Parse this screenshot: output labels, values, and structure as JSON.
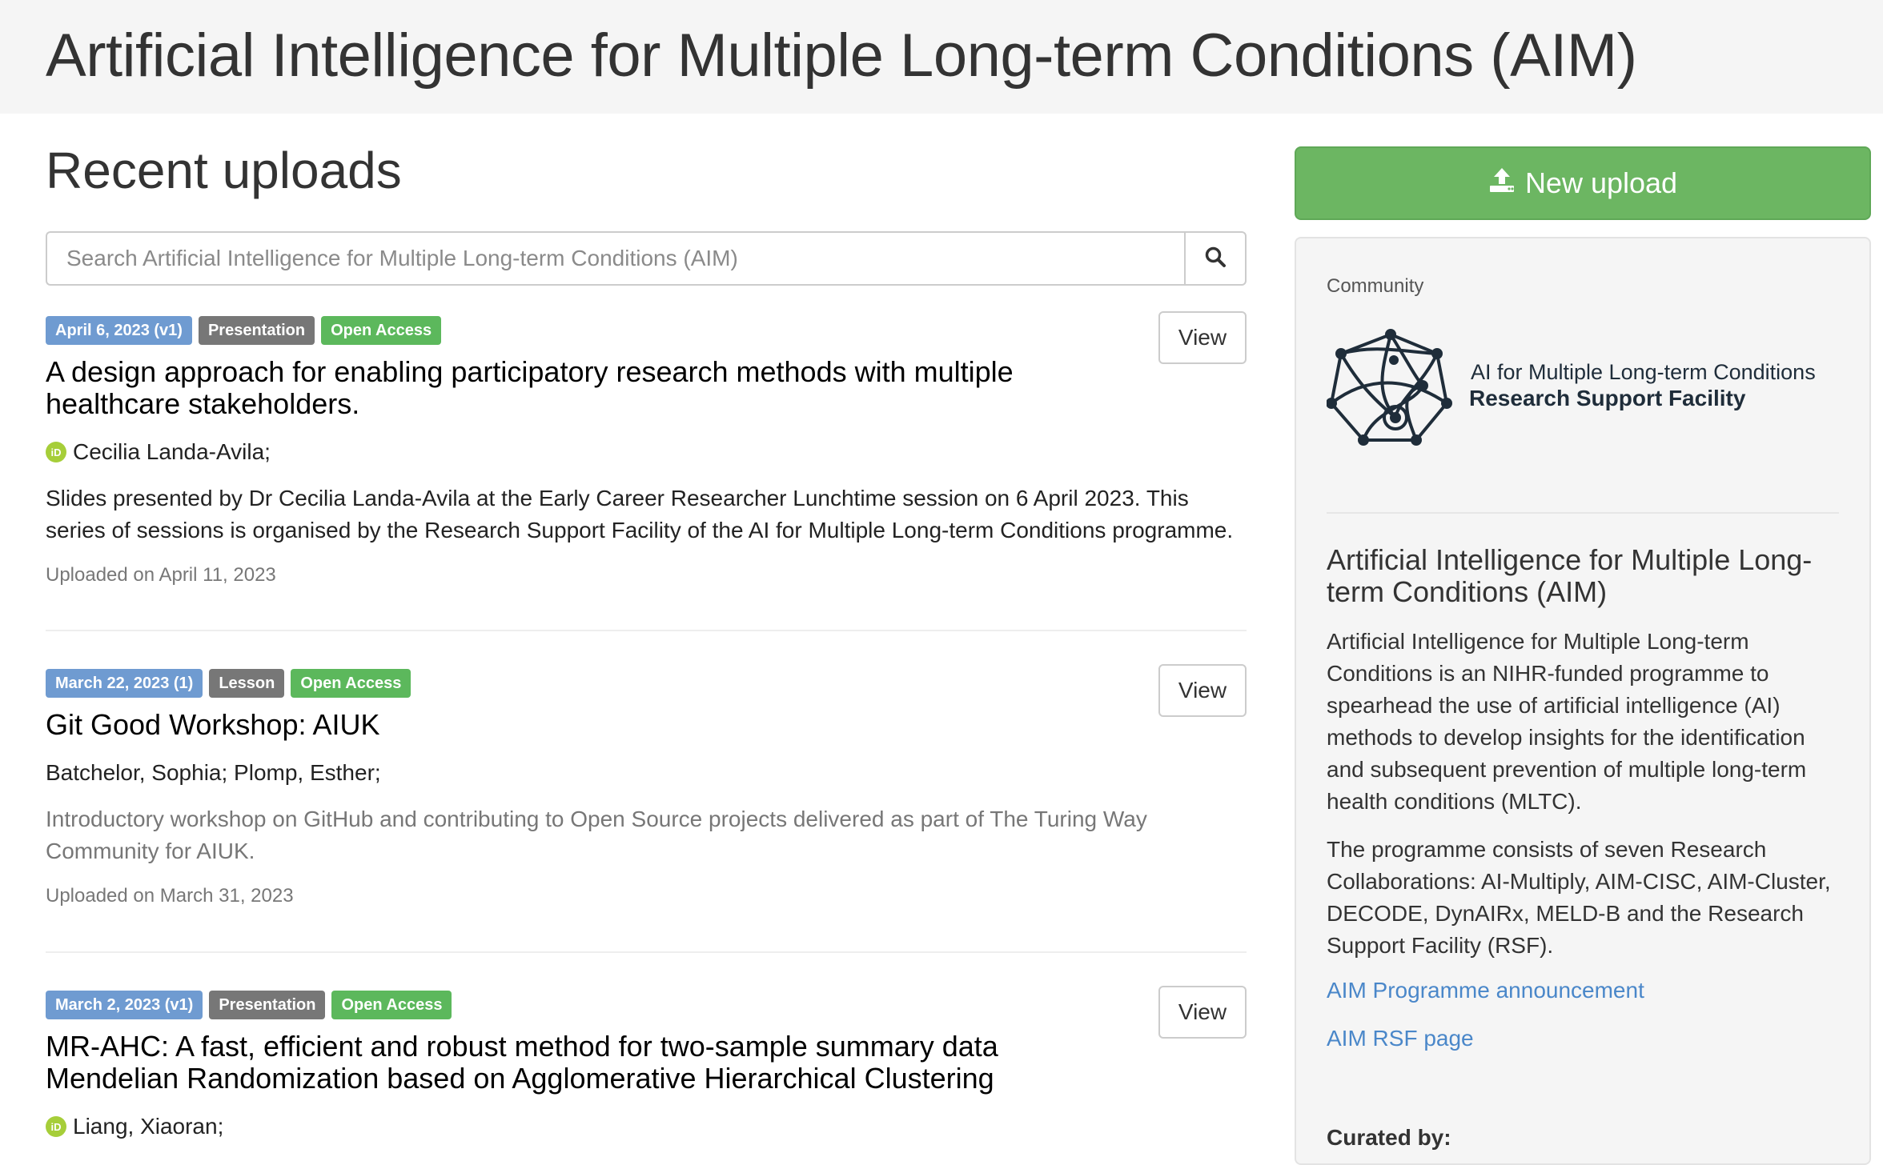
{
  "header": {
    "title": "Artificial Intelligence for Multiple Long-term Conditions (AIM)"
  },
  "main": {
    "section_title": "Recent uploads",
    "search": {
      "placeholder": "Search Artificial Intelligence for Multiple Long-term Conditions (AIM)",
      "icon": "search-icon"
    },
    "records": [
      {
        "date_label": "April 6, 2023 (v1)",
        "type_label": "Presentation",
        "access_label": "Open Access",
        "view_label": "View",
        "title": "A design approach for enabling participatory research methods with multiple healthcare stakeholders.",
        "creators": "Cecilia Landa-Avila;",
        "has_orcid": true,
        "description": "Slides presented by Dr Cecilia Landa-Avila at the Early Career Researcher Lunchtime session on 6 April 2023. This series of sessions is organised by the Research Support Facility of the AI for Multiple Long-term Conditions programme.",
        "uploaded": "Uploaded on April 11, 2023"
      },
      {
        "date_label": "March 22, 2023 (1)",
        "type_label": "Lesson",
        "access_label": "Open Access",
        "view_label": "View",
        "title": "Git Good Workshop: AIUK",
        "creators": "Batchelor, Sophia; Plomp, Esther;",
        "has_orcid": false,
        "description": "Introductory workshop on GitHub and contributing to Open Source projects delivered as part of The Turing Way Community for AIUK.",
        "uploaded": "Uploaded on March 31, 2023"
      },
      {
        "date_label": "March 2, 2023 (v1)",
        "type_label": "Presentation",
        "access_label": "Open Access",
        "view_label": "View",
        "title": "MR-AHC: A fast, efficient and robust method for two-sample summary data Mendelian Randomization based on Agglomerative Hierarchical Clustering",
        "creators": "Liang, Xiaoran;",
        "has_orcid": true
      }
    ]
  },
  "sidebar": {
    "new_upload_label": "New upload",
    "new_upload_icon": "upload-icon",
    "community_label": "Community",
    "logo": {
      "line1": "AI for Multiple Long-term Conditions",
      "line2": "Research Support Facility"
    },
    "title": "Artificial Intelligence for Multiple Long-term Conditions (AIM)",
    "paragraph1": "Artificial Intelligence for Multiple Long-term Conditions is an NIHR-funded programme to spearhead the use of artificial intelligence (AI) methods to develop insights for the identification and subsequent prevention of multiple long-term health conditions (MLTC).",
    "paragraph2": "The programme consists of seven Research Collaborations: AI-Multiply, AIM-CISC, AIM-Cluster, DECODE, DynAIRx, MELD-B and the Research Support Facility (RSF).",
    "link1": "AIM Programme announcement",
    "link2": "AIM RSF page",
    "curated_by": "Curated by:"
  },
  "colors": {
    "primary_link": "#4a87c9",
    "upload_green": "#6cb662",
    "label_date": "#6f9bd1",
    "label_type": "#777777",
    "label_access": "#5cb85c"
  }
}
